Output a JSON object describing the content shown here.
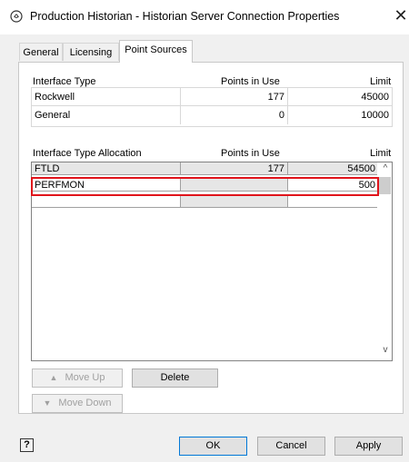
{
  "window": {
    "title": "Production Historian - Historian Server Connection Properties",
    "close_glyph": "✕"
  },
  "tabs": [
    {
      "label": "General",
      "active": false
    },
    {
      "label": "Licensing",
      "active": false
    },
    {
      "label": "Point Sources",
      "active": true
    }
  ],
  "interface_types": {
    "headers": [
      "Interface Type",
      "Points in Use",
      "Limit"
    ],
    "rows": [
      {
        "type": "Rockwell",
        "points_in_use": "177",
        "limit": "45000"
      },
      {
        "type": "General",
        "points_in_use": "0",
        "limit": "10000"
      }
    ]
  },
  "allocation": {
    "headers": [
      "Interface Type Allocation",
      "Points in Use",
      "Limit"
    ],
    "rows": [
      {
        "type": "FTLD",
        "points_in_use": "177",
        "limit": "54500"
      },
      {
        "type": "PERFMON",
        "points_in_use": "",
        "limit": "500"
      },
      {
        "type": "",
        "points_in_use": "",
        "limit": ""
      }
    ],
    "scroll_up_glyph": "^",
    "scroll_down_glyph": "v"
  },
  "buttons": {
    "move_up": "Move Up",
    "move_up_glyph": "▲",
    "move_down": "Move Down",
    "move_down_glyph": "▼",
    "delete": "Delete",
    "ok": "OK",
    "cancel": "Cancel",
    "apply": "Apply",
    "help_glyph": "?"
  },
  "colors": {
    "highlight_border": "#e0141b",
    "selected_row_bg": "#e6e6e6"
  }
}
